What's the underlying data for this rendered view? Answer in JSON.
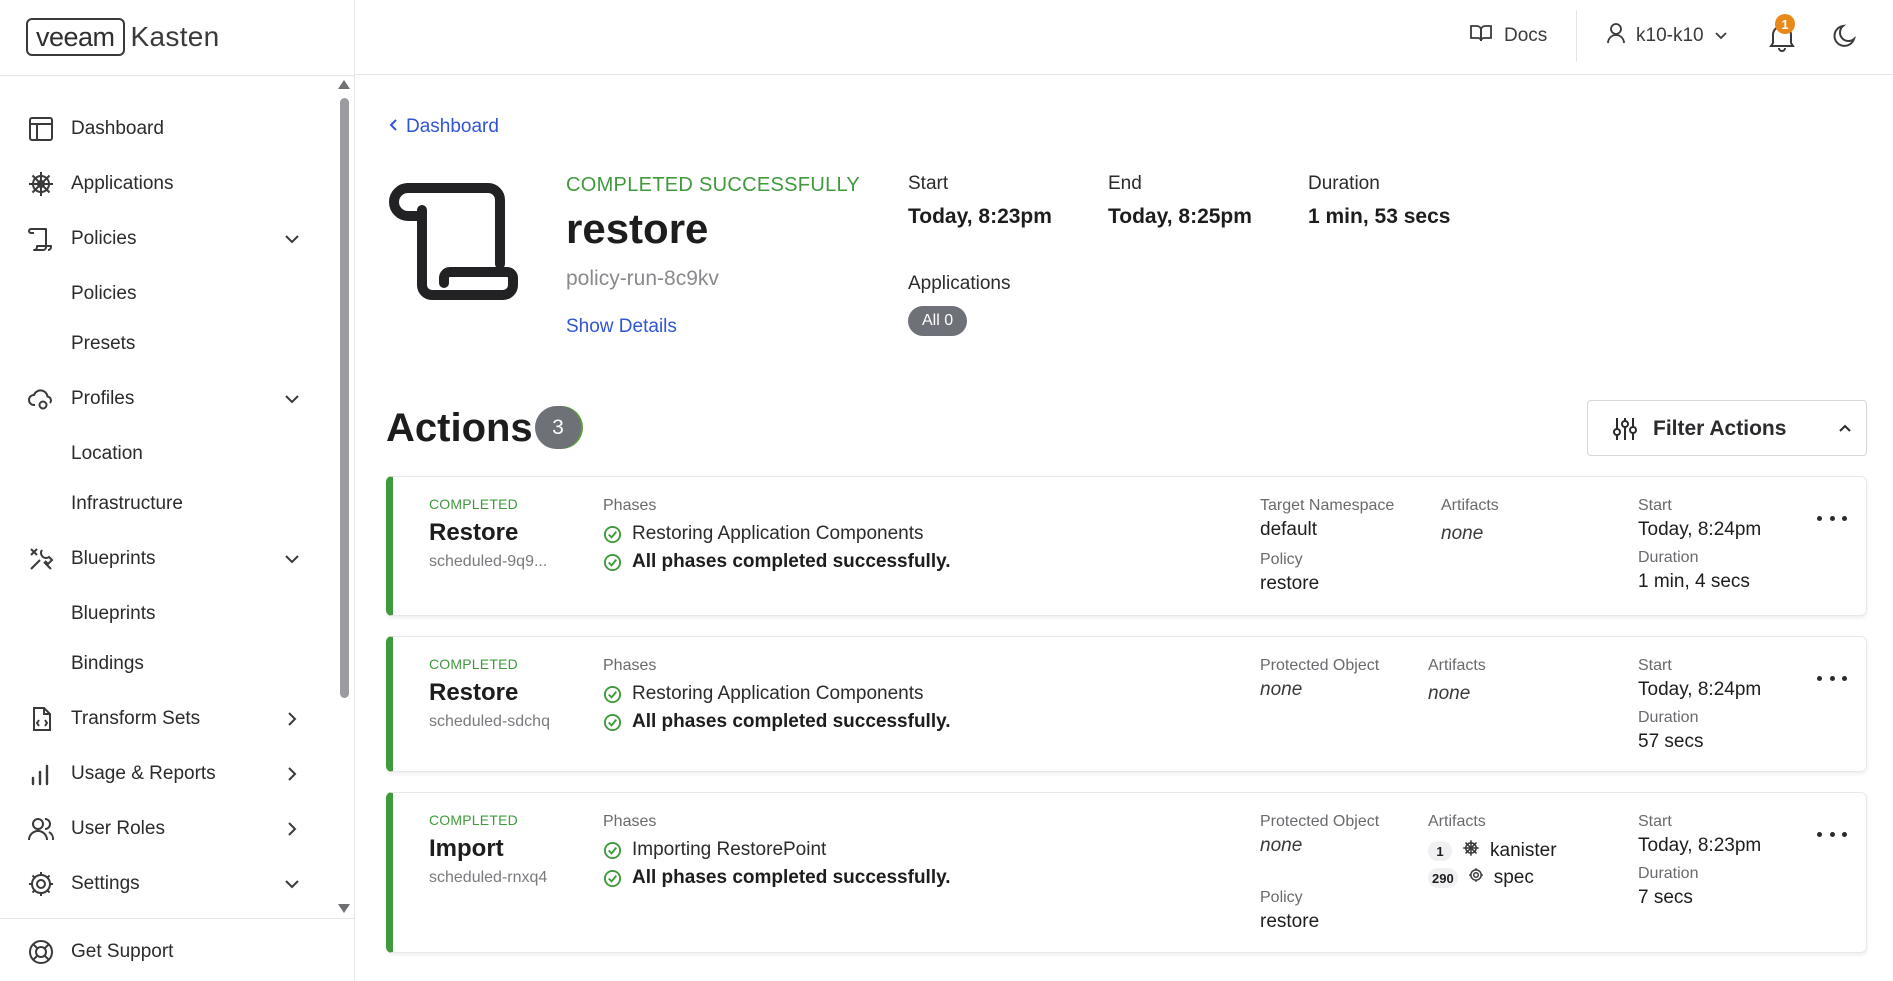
{
  "brand": {
    "box_text": "veeam",
    "name": "Kasten"
  },
  "header": {
    "docs_label": "Docs",
    "user_label": "k10-k10",
    "notification_count": "1"
  },
  "sidebar": {
    "items": [
      {
        "label": "Dashboard",
        "icon": "dashboard-icon"
      },
      {
        "label": "Applications",
        "icon": "helm-icon"
      },
      {
        "label": "Policies",
        "icon": "scroll-icon"
      },
      {
        "label": "Policies"
      },
      {
        "label": "Presets"
      },
      {
        "label": "Profiles",
        "icon": "cloud-gear-icon"
      },
      {
        "label": "Location"
      },
      {
        "label": "Infrastructure"
      },
      {
        "label": "Blueprints",
        "icon": "tools-icon"
      },
      {
        "label": "Blueprints"
      },
      {
        "label": "Bindings"
      },
      {
        "label": "Transform Sets",
        "icon": "file-code-icon"
      },
      {
        "label": "Usage & Reports",
        "icon": "bar-chart-icon"
      },
      {
        "label": "User Roles",
        "icon": "users-icon"
      },
      {
        "label": "Settings",
        "icon": "gear-icon"
      }
    ],
    "support_label": "Get Support"
  },
  "breadcrumb": {
    "back_label": "Dashboard"
  },
  "run": {
    "status": "COMPLETED SUCCESSFULLY",
    "name": "restore",
    "id": "policy-run-8c9kv",
    "show_details": "Show Details",
    "start_label": "Start",
    "start_value": "Today, 8:23pm",
    "end_label": "End",
    "end_value": "Today, 8:25pm",
    "duration_label": "Duration",
    "duration_value": "1 min, 53 secs",
    "applications_label": "Applications",
    "applications_pill": "All 0"
  },
  "actions": {
    "title": "Actions",
    "count": "3",
    "filter_label": "Filter Actions",
    "cards": [
      {
        "status": "COMPLETED",
        "name": "Restore",
        "sub": "scheduled-9q9...",
        "phases_label": "Phases",
        "phase1": "Restoring Application Components",
        "phase2": "All phases completed successfully.",
        "col1_label": "Target Namespace",
        "col1_value": "default",
        "col1b_label": "Policy",
        "col1b_value": "restore",
        "artifacts_label": "Artifacts",
        "artifacts_value": "none",
        "start_label": "Start",
        "start_value": "Today, 8:24pm",
        "duration_label": "Duration",
        "duration_value": "1 min, 4 secs"
      },
      {
        "status": "COMPLETED",
        "name": "Restore",
        "sub": "scheduled-sdchq",
        "phases_label": "Phases",
        "phase1": "Restoring Application Components",
        "phase2": "All phases completed successfully.",
        "col1_label": "Protected Object",
        "col1_value": "none",
        "artifacts_label": "Artifacts",
        "artifacts_value": "none",
        "start_label": "Start",
        "start_value": "Today, 8:24pm",
        "duration_label": "Duration",
        "duration_value": "57 secs"
      },
      {
        "status": "COMPLETED",
        "name": "Import",
        "sub": "scheduled-rnxq4",
        "phases_label": "Phases",
        "phase1": "Importing RestorePoint",
        "phase2": "All phases completed successfully.",
        "col1_label": "Protected Object",
        "col1_value": "none",
        "col1b_label": "Policy",
        "col1b_value": "restore",
        "artifacts_label": "Artifacts",
        "artifact1_count": "1",
        "artifact1_name": "kanister",
        "artifact2_count": "290",
        "artifact2_name": "spec",
        "start_label": "Start",
        "start_value": "Today, 8:23pm",
        "duration_label": "Duration",
        "duration_value": "7 secs"
      }
    ]
  },
  "colors": {
    "accent_link": "#2f55d4",
    "success": "#3f9a3c",
    "pill": "#6e7178",
    "badge": "#e8891a"
  }
}
